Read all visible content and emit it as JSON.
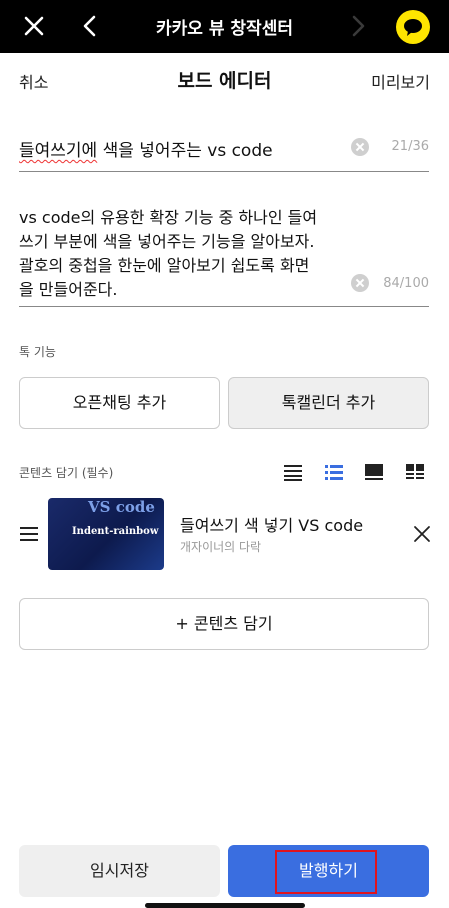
{
  "appbar": {
    "title": "카카오 뷰 창작센터"
  },
  "editor": {
    "cancel_label": "취소",
    "title": "보드 에디터",
    "preview_label": "미리보기"
  },
  "title_field": {
    "value_misspelled": "들여쓰기에",
    "value_rest": " 색을 넣어주는 vs code",
    "counter": "21/36"
  },
  "description_field": {
    "value": "vs code의 유용한 확장 기능 중 하나인 들여\n쓰기 부분에 색을 넣어주는 기능을 알아보자.\n괄호의 중첩을 한눈에 알아보기 쉽도록 화면\n을 만들어준다.",
    "counter": "84/100"
  },
  "talk_features": {
    "label": "톡 기능",
    "open_chat_label": "오픈채팅 추가",
    "talk_calendar_label": "톡캘린더 추가"
  },
  "contents": {
    "label": "콘텐츠 담기 (필수)",
    "view_modes": [
      "list-plain-icon",
      "list-bulleted-icon",
      "card-large-icon",
      "grid-icon"
    ],
    "selected_view_mode": "list-bulleted-icon",
    "items": [
      {
        "thumb_title": "VS code",
        "thumb_subtitle": "Indent-rainbow",
        "title": "들여쓰기 색 넣기 VS code",
        "source": "개자이너의 다락"
      }
    ],
    "add_label": "+ 콘텐츠 담기"
  },
  "bottom": {
    "save_label": "임시저장",
    "publish_label": "발행하기"
  },
  "colors": {
    "accent_blue": "#3a6ee0",
    "kakao_yellow": "#fee500",
    "highlight_red": "#e0141e"
  }
}
